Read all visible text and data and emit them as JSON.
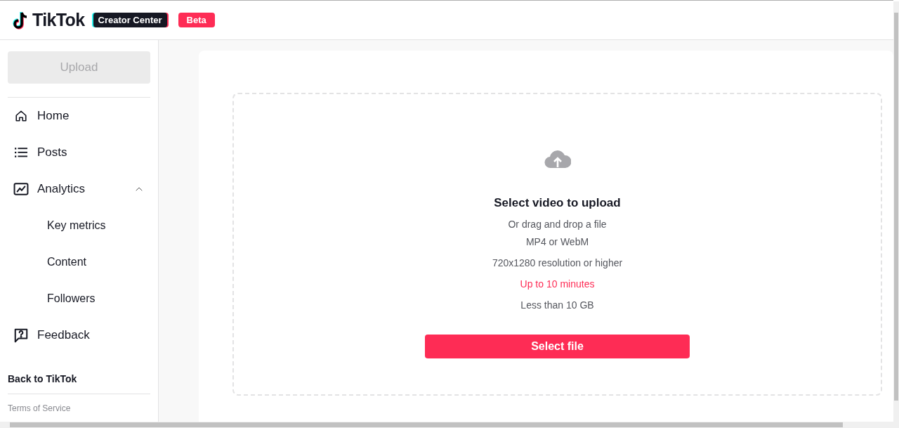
{
  "header": {
    "logo_text": "TikTok",
    "product": "Creator Center",
    "badge": "Beta"
  },
  "sidebar": {
    "upload_button": {
      "label": "Upload",
      "disabled": true
    },
    "items": [
      {
        "kind": "home",
        "label": "Home"
      },
      {
        "kind": "posts",
        "label": "Posts"
      },
      {
        "kind": "analytics",
        "label": "Analytics",
        "expanded": true,
        "children": [
          {
            "label": "Key metrics"
          },
          {
            "label": "Content"
          },
          {
            "label": "Followers"
          }
        ]
      },
      {
        "kind": "feedback",
        "label": "Feedback"
      }
    ],
    "back_link": "Back to TikTok",
    "footer_link": "Terms of Service"
  },
  "upload": {
    "title": "Select video to upload",
    "lines": [
      {
        "text": "Or drag and drop a file",
        "highlight": false
      },
      {
        "text": "MP4 or WebM",
        "highlight": false
      },
      {
        "text": "720x1280 resolution or higher",
        "highlight": false
      },
      {
        "text": "Up to 10 minutes",
        "highlight": true
      },
      {
        "text": "Less than 10 GB",
        "highlight": false
      }
    ],
    "button": "Select file"
  }
}
